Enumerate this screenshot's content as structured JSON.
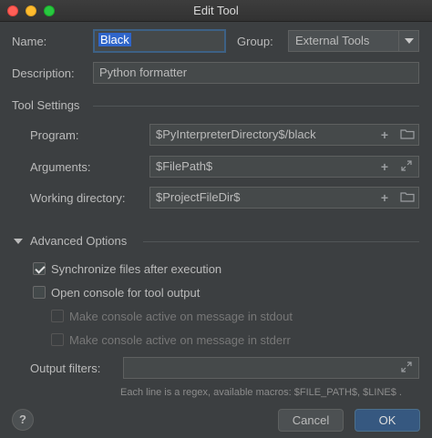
{
  "window": {
    "title": "Edit Tool"
  },
  "form": {
    "name_label": "Name:",
    "name_value": "Black",
    "group_label": "Group:",
    "group_value": "External Tools",
    "description_label": "Description:",
    "description_value": "Python formatter"
  },
  "tool_settings": {
    "heading": "Tool Settings",
    "program_label": "Program:",
    "program_value": "$PyInterpreterDirectory$/black",
    "arguments_label": "Arguments:",
    "arguments_value": "$FilePath$",
    "working_dir_label": "Working directory:",
    "working_dir_value": "$ProjectFileDir$"
  },
  "advanced": {
    "heading": "Advanced Options",
    "sync_files_label": "Synchronize files after execution",
    "sync_files_checked": true,
    "open_console_label": "Open console for tool output",
    "open_console_checked": false,
    "stdout_label": "Make console active on message in stdout",
    "stderr_label": "Make console active on message in stderr",
    "output_filters_label": "Output filters:",
    "output_filters_value": "",
    "hint": "Each line is a regex, available macros: $FILE_PATH$, $LINE$ ."
  },
  "buttons": {
    "help": "?",
    "cancel": "Cancel",
    "ok": "OK"
  },
  "icons": {
    "add": "plus-icon",
    "browse": "folder-icon",
    "expand": "expand-icon"
  },
  "colors": {
    "background": "#3c3f41",
    "accent": "#365880",
    "selection": "#2f65ca"
  }
}
